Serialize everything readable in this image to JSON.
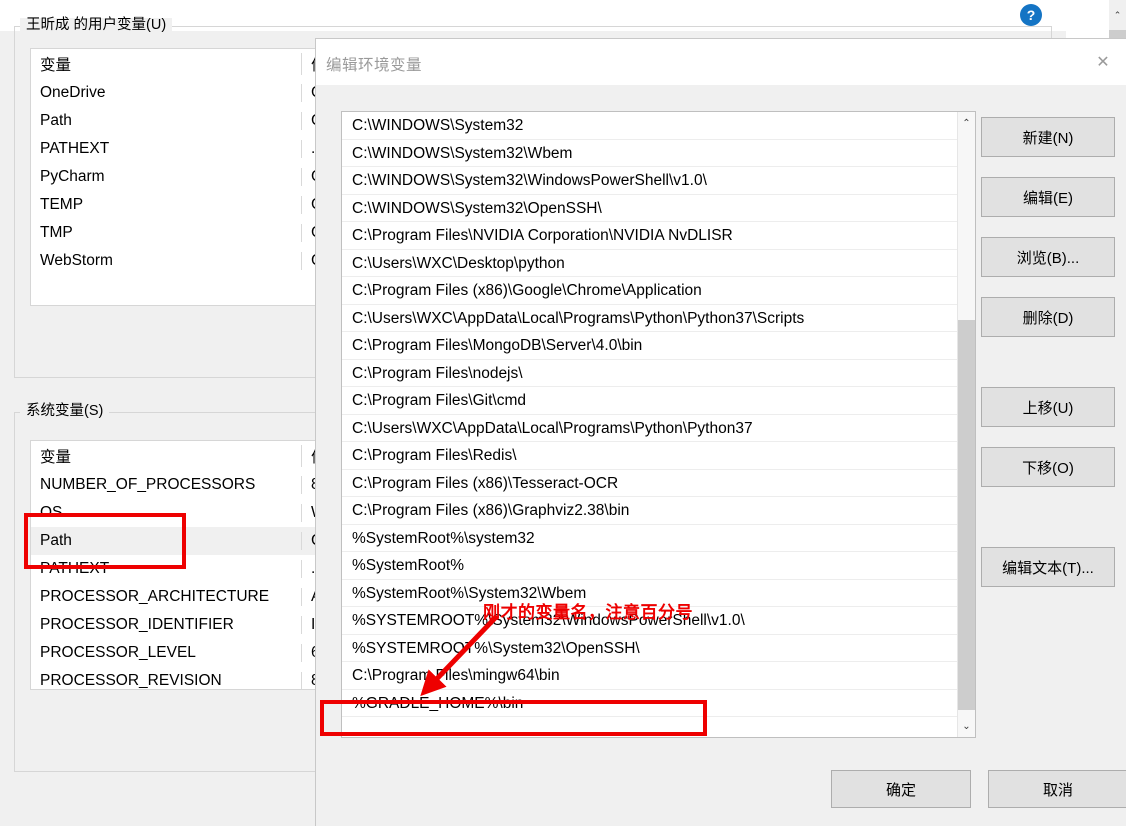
{
  "background_window": {
    "close_label": "✕",
    "help_label": "?",
    "user_group": {
      "legend": "王昕成 的用户变量(U)",
      "headers": {
        "name": "变量",
        "value": "值"
      },
      "rows": [
        {
          "name": "OneDrive",
          "value": "C"
        },
        {
          "name": "Path",
          "value": "C"
        },
        {
          "name": "PATHEXT",
          "value": ".C"
        },
        {
          "name": "PyCharm",
          "value": "C"
        },
        {
          "name": "TEMP",
          "value": "C"
        },
        {
          "name": "TMP",
          "value": "C"
        },
        {
          "name": "WebStorm",
          "value": "C"
        }
      ]
    },
    "system_group": {
      "legend": "系统变量(S)",
      "headers": {
        "name": "变量",
        "value": "值"
      },
      "rows": [
        {
          "name": "NUMBER_OF_PROCESSORS",
          "value": "8"
        },
        {
          "name": "OS",
          "value": "W"
        },
        {
          "name": "Path",
          "value": "C"
        },
        {
          "name": "PATHEXT",
          "value": ".C"
        },
        {
          "name": "PROCESSOR_ARCHITECTURE",
          "value": "A"
        },
        {
          "name": "PROCESSOR_IDENTIFIER",
          "value": "In"
        },
        {
          "name": "PROCESSOR_LEVEL",
          "value": "6"
        },
        {
          "name": "PROCESSOR_REVISION",
          "value": "8"
        }
      ]
    }
  },
  "dialog": {
    "title": "编辑环境变量",
    "close_label": "✕",
    "path_entries": [
      "C:\\WINDOWS\\System32",
      "C:\\WINDOWS\\System32\\Wbem",
      "C:\\WINDOWS\\System32\\WindowsPowerShell\\v1.0\\",
      "C:\\WINDOWS\\System32\\OpenSSH\\",
      "C:\\Program Files\\NVIDIA Corporation\\NVIDIA NvDLISR",
      "C:\\Users\\WXC\\Desktop\\python",
      "C:\\Program Files (x86)\\Google\\Chrome\\Application",
      "C:\\Users\\WXC\\AppData\\Local\\Programs\\Python\\Python37\\Scripts",
      "C:\\Program Files\\MongoDB\\Server\\4.0\\bin",
      "C:\\Program Files\\nodejs\\",
      "C:\\Program Files\\Git\\cmd",
      "C:\\Users\\WXC\\AppData\\Local\\Programs\\Python\\Python37",
      "C:\\Program Files\\Redis\\",
      "C:\\Program Files (x86)\\Tesseract-OCR",
      "C:\\Program Files (x86)\\Graphviz2.38\\bin",
      "%SystemRoot%\\system32",
      "%SystemRoot%",
      "%SystemRoot%\\System32\\Wbem",
      "%SYSTEMROOT%\\System32\\WindowsPowerShell\\v1.0\\",
      "%SYSTEMROOT%\\System32\\OpenSSH\\",
      "C:\\Program Files\\mingw64\\bin",
      "%GRADLE_HOME%\\bin"
    ],
    "side_buttons": [
      {
        "id": "new",
        "label": "新建(N)"
      },
      {
        "id": "edit",
        "label": "编辑(E)"
      },
      {
        "id": "browse",
        "label": "浏览(B)..."
      },
      {
        "id": "delete",
        "label": "删除(D)"
      },
      {
        "id": "move_up",
        "label": "上移(U)"
      },
      {
        "id": "move_down",
        "label": "下移(O)"
      },
      {
        "id": "edit_text",
        "label": "编辑文本(T)..."
      }
    ],
    "ok_label": "确定",
    "cancel_label": "取消",
    "scroll_up_label": "⌃",
    "scroll_down_label": "⌄"
  },
  "annotations": {
    "note_text": "刚才的变量名，注意百分号",
    "color": "#ee0000",
    "highlight_path_variable": "Path",
    "highlight_entry": "%GRADLE_HOME%\\bin"
  }
}
